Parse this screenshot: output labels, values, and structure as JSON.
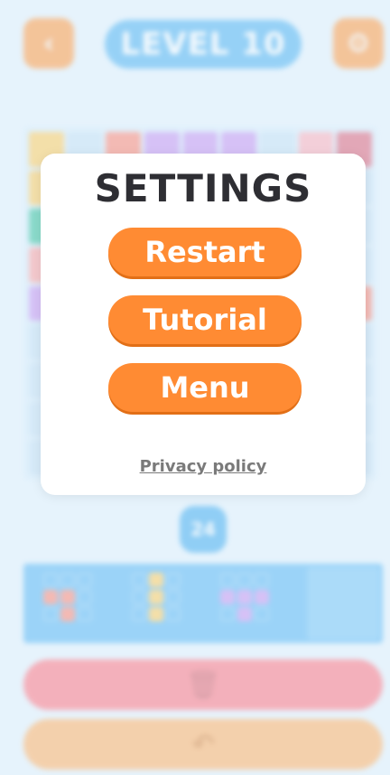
{
  "header": {
    "back_icon": "chevron-left-icon",
    "level_label": "LEVEL 10",
    "settings_icon": "gear-icon"
  },
  "board": {
    "rows": 9,
    "cols": 9,
    "cells": [
      [
        "#ffcf66",
        "#c9e3f6",
        "#ff8c7a",
        "#c99af2",
        "#c99af2",
        "#c99af2",
        "#c9e3f6",
        "#ffb2bd",
        "#e06a80"
      ],
      [
        "#ffcf66",
        "#c9e3f6",
        "#c9e3f6",
        "#c9e3f6",
        "#c9e3f6",
        "#c9e3f6",
        "#c9e3f6",
        "#c9e3f6",
        "#c9e3f6"
      ],
      [
        "#3fc6a3",
        "#c9e3f6",
        "#c9e3f6",
        "#c9e3f6",
        "#c9e3f6",
        "#c9e3f6",
        "#c9e3f6",
        "#c9e3f6",
        "#c9e3f6"
      ],
      [
        "#ffa5a5",
        "#c9e3f6",
        "#c9e3f6",
        "#c9e3f6",
        "#c9e3f6",
        "#c9e3f6",
        "#c9e3f6",
        "#c9e3f6",
        "#c9e3f6"
      ],
      [
        "#c99af2",
        "#c9e3f6",
        "#c9e3f6",
        "#c9e3f6",
        "#c9e3f6",
        "#c9e3f6",
        "#c9e3f6",
        "#c9e3f6",
        "#ff8c7a"
      ],
      [
        "#c9e3f6",
        "#c9e3f6",
        "#c9e3f6",
        "#c9e3f6",
        "#c9e3f6",
        "#c9e3f6",
        "#c9e3f6",
        "#c9e3f6",
        "#c9e3f6"
      ],
      [
        "#c9e3f6",
        "#c9e3f6",
        "#c9e3f6",
        "#c9e3f6",
        "#c9e3f6",
        "#c9e3f6",
        "#c9e3f6",
        "#c9e3f6",
        "#c9e3f6"
      ],
      [
        "#c9e3f6",
        "#c9e3f6",
        "#c9e3f6",
        "#c9e3f6",
        "#c9e3f6",
        "#c9e3f6",
        "#c9e3f6",
        "#c9e3f6",
        "#c9e3f6"
      ],
      [
        "#c9e3f6",
        "#c9e3f6",
        "#c9e3f6",
        "#c9e3f6",
        "#c9e3f6",
        "#c9e3f6",
        "#c9e3f6",
        "#c9e3f6",
        "#c9e3f6"
      ]
    ]
  },
  "counter": {
    "value": "24"
  },
  "pieces": [
    {
      "color": "#ff8c7a",
      "cells": [
        0,
        0,
        0,
        1,
        1,
        0,
        0,
        1,
        0
      ]
    },
    {
      "color": "#ffcf66",
      "cells": [
        0,
        1,
        0,
        0,
        1,
        0,
        0,
        1,
        0
      ]
    },
    {
      "color": "#c99af2",
      "cells": [
        0,
        0,
        0,
        1,
        1,
        1,
        0,
        1,
        0
      ]
    }
  ],
  "actions": {
    "trash_icon": "trash-icon",
    "undo_icon": "undo-icon"
  },
  "modal": {
    "title": "SETTINGS",
    "buttons": [
      {
        "label": "Restart"
      },
      {
        "label": "Tutorial"
      },
      {
        "label": "Menu"
      }
    ],
    "privacy_link": "Privacy policy"
  },
  "colors": {
    "accent_orange": "#ff8b33",
    "accent_blue": "#56b6f2",
    "background": "#e6f3fc"
  }
}
